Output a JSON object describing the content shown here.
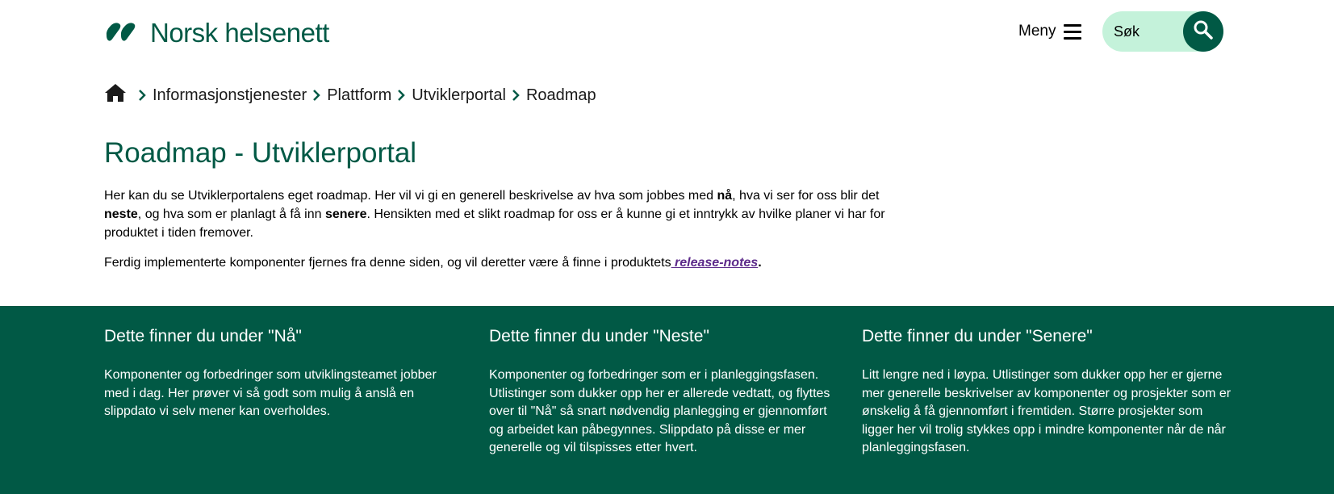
{
  "header": {
    "logo_text": "Norsk helsenett",
    "menu_label": "Meny",
    "search_placeholder": "Søk",
    "brand_color": "#015945",
    "search_bg": "#c4f2da"
  },
  "breadcrumb": {
    "home_icon": "home-icon",
    "items": [
      "Informasjonstjenester",
      "Plattform",
      "Utviklerportal",
      "Roadmap"
    ]
  },
  "main": {
    "title": "Roadmap - Utviklerportal",
    "intro": {
      "p1": "Her kan du se Utviklerportalens eget roadmap. Her vil vi gi en generell beskrivelse av hva som jobbes med ",
      "b1": "nå",
      "p2": ", hva vi ser for oss blir det ",
      "b2": "neste",
      "p3": ", og hva som er planlagt å få inn ",
      "b3": "senere",
      "p4": ". Hensikten med et slikt roadmap for oss er å kunne gi et inntrykk av hvilke planer vi har for produktet i tiden fremover."
    },
    "release_note": {
      "text": "Ferdig implementerte komponenter fjernes fra denne siden, og vil deretter være å finne i produktets",
      "link": " release-notes",
      "trailing": "."
    }
  },
  "columns": [
    {
      "title": "Dette finner du under \"Nå\"",
      "text": "Komponenter og forbedringer som utviklingsteamet jobber med i dag. Her prøver vi så godt som mulig å anslå en slippdato vi selv mener kan overholdes."
    },
    {
      "title": "Dette finner du under \"Neste\"",
      "text": "Komponenter og forbedringer som er i planleggingsfasen. Utlistinger som dukker opp her er allerede vedtatt, og flyttes over til \"Nå\" så snart nødvendig planlegging er gjennomført og arbeidet kan påbegynnes. Slippdato på disse er mer generelle og vil tilspisses etter hvert."
    },
    {
      "title": "Dette finner du under \"Senere\"",
      "text": "Litt lengre ned i løypa. Utlistinger som dukker opp her er gjerne mer generelle beskrivelser av komponenter og prosjekter som er ønskelig å få gjennomført i fremtiden. Større prosjekter som ligger her vil trolig stykkes opp i mindre komponenter når de når planleggingsfasen."
    }
  ]
}
